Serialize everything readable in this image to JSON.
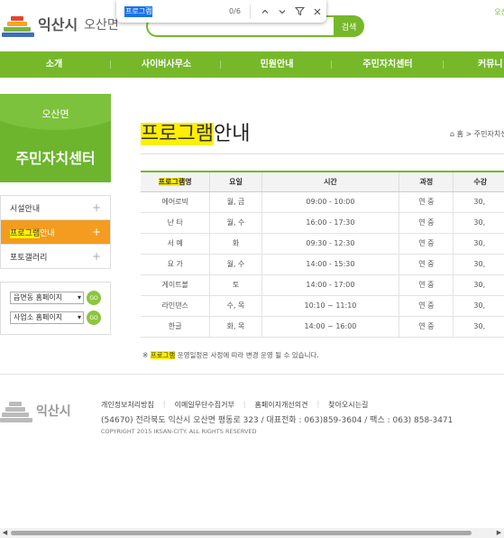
{
  "header": {
    "city_name": "익산시",
    "town_name": "오산면",
    "search_button": "검색",
    "top_right_text": "오산"
  },
  "find_bar": {
    "query": "프로그램",
    "count": "0/6",
    "prev_icon": "chevron-up-icon",
    "next_icon": "chevron-down-icon",
    "filter_icon": "filter-icon",
    "close_icon": "close-icon"
  },
  "nav": {
    "items": [
      "소개",
      "사이버사무소",
      "민원안내",
      "주민자치센터",
      "커뮤니"
    ]
  },
  "sidebar": {
    "subtitle": "오산면",
    "title": "주민자치센터",
    "menu": [
      {
        "label": "시설안내"
      },
      {
        "label_highlight": "프로그램",
        "label_rest": "안내"
      },
      {
        "label": "포토갤러리"
      }
    ],
    "quick_links": [
      {
        "select_value": "읍면동 홈페이지",
        "go": "GO"
      },
      {
        "select_value": "사업소 홈페이지",
        "go": "GO"
      }
    ]
  },
  "content": {
    "title_highlight": "프로그램",
    "title_rest": "안내",
    "breadcrumb_home": "홈",
    "breadcrumb_current": "주민자치센",
    "table": {
      "header_highlight": "프로그램",
      "header_rest": "명",
      "headers": [
        "요일",
        "시간",
        "과정",
        "수강"
      ],
      "rows": [
        [
          "에어로빅",
          "월, 금",
          "09:00 - 10:00",
          "연 중",
          "30,"
        ],
        [
          "난 타",
          "월, 수",
          "16:00 - 17:30",
          "연 중",
          "30,"
        ],
        [
          "서 예",
          "화",
          "09:30 - 12:30",
          "연 중",
          "30,"
        ],
        [
          "요 가",
          "월, 수",
          "14:00 - 15:30",
          "연 중",
          "30,"
        ],
        [
          "게이트볼",
          "토",
          "14:00 - 17:00",
          "연 중",
          "30,"
        ],
        [
          "라인댄스",
          "수, 목",
          "10:10 ~ 11:10",
          "연 중",
          "30,"
        ],
        [
          "한글",
          "화, 목",
          "14:00 ~ 16:00",
          "연 중",
          "30,"
        ]
      ]
    },
    "note_prefix": "※",
    "note_highlight": "프로그램",
    "note_rest": "운영일정은 사정에 따라 변경 운영 될 수 있습니다."
  },
  "footer": {
    "city_name": "익산시",
    "links": [
      "개인정보처리방침",
      "이메일무단수집거부",
      "홈페이지개선의견",
      "찾아오시는길"
    ],
    "address": "(54670) 전라북도 익산시 오산면 평동로 323 / 대표전화 : 063)859-3604 / 팩스 : 063) 858-3471",
    "copyright": "COPYRIGHT 2015 IKSAN-CITY. ALL RIGHTS RESERVED"
  },
  "colors": {
    "brand_green": "#76b82a",
    "active_orange": "#f39c1f",
    "highlight_yellow": "#ffef00"
  }
}
